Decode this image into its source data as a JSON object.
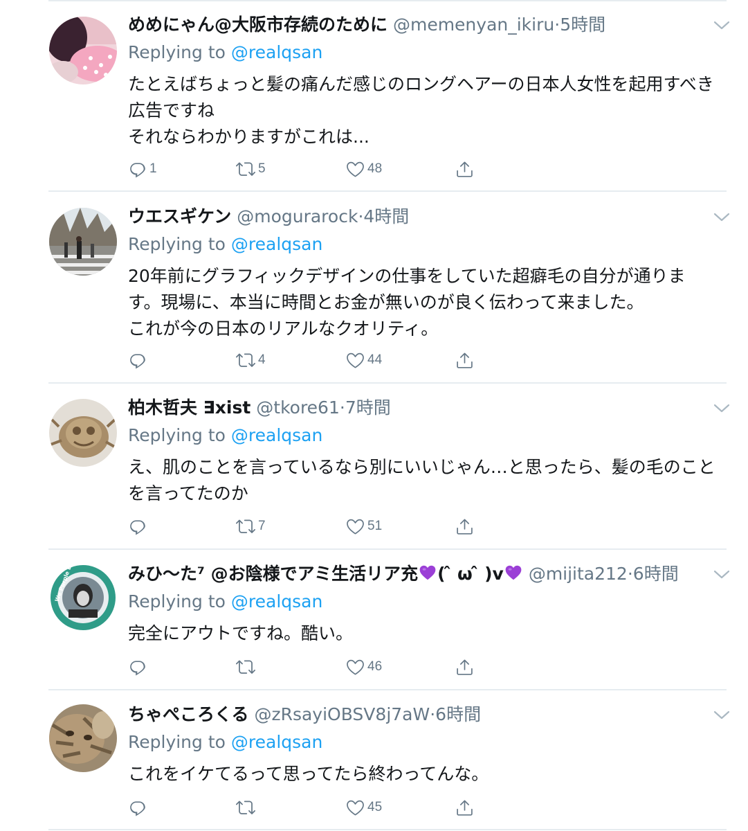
{
  "replying_label": "Replying to",
  "tweets": [
    {
      "name": "めめにゃん@大阪市存続のために",
      "handle": "@memenyan_ikiru",
      "dot": "·",
      "time": "5時間",
      "mention": "@realqsan",
      "lines": [
        "たとえばちょっと髪の痛んだ感じのロングヘアーの日本人女性を起用すべき",
        "広告ですね",
        "それならわかりますがこれは..."
      ],
      "replies": "1",
      "retweets": "5",
      "likes": "48"
    },
    {
      "name": "ウエスギケン",
      "handle": "@mogurarock",
      "dot": "·",
      "time": "4時間",
      "mention": "@realqsan",
      "lines": [
        "20年前にグラフィックデザインの仕事をしていた超癖毛の自分が通りま",
        "す。現場に、本当に時間とお金が無いのが良く伝わって来ました。",
        "これが今の日本のリアルなクオリティ。"
      ],
      "replies": "",
      "retweets": "4",
      "likes": "44"
    },
    {
      "name": "柏木哲夫 ∃xist",
      "handle": "@tkore61",
      "dot": "·",
      "time": "7時間",
      "mention": "@realqsan",
      "lines": [
        "え、肌のことを言っているなら別にいいじゃん…と思ったら、髪の毛のこと",
        "を言ってたのか"
      ],
      "replies": "",
      "retweets": "7",
      "likes": "51"
    },
    {
      "name_part1": "みひ〜た⁷ @お陰様でアミ生活リア充",
      "name_part2": "( ̂ ω ̂ )v",
      "handle": "@mijita212",
      "dot": "·",
      "time": "6時間",
      "mention": "@realqsan",
      "lines": [
        "完全にアウトですね。酷い。"
      ],
      "replies": "",
      "retweets": "",
      "likes": "46",
      "avatar_text": "We Purple Earth"
    },
    {
      "name": "ちゃぺころくる",
      "handle": "@zRsayiOBSV8j7aW",
      "dot": "·",
      "time": "6時間",
      "mention": "@realqsan",
      "lines": [
        "これをイケてるって思ってたら終わってんな。"
      ],
      "replies": "",
      "retweets": "",
      "likes": "45"
    }
  ],
  "colors": {
    "text": "#14171a",
    "secondary": "#657786",
    "link": "#1da1f2",
    "divider": "#e6ecf0",
    "purple_heart": "#9b3fd6"
  },
  "icons": [
    "reply-icon",
    "retweet-icon",
    "like-icon",
    "share-icon",
    "chevron-down-icon",
    "purple-heart-icon"
  ]
}
